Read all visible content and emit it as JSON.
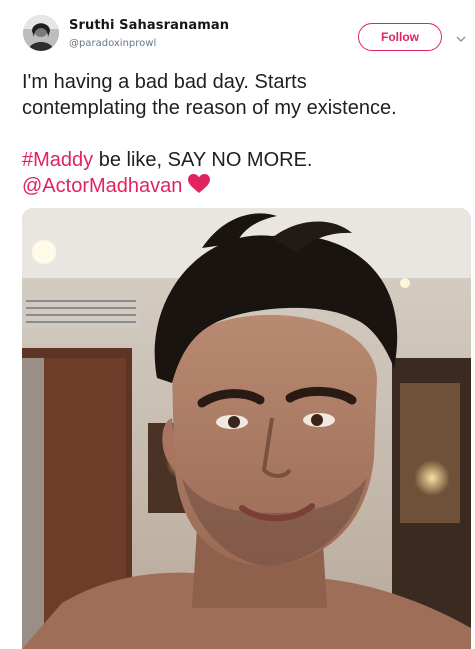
{
  "author": {
    "display_name": "Sruthi Sahasranaman",
    "handle": "@paradoxinprowl"
  },
  "actions": {
    "follow_label": "Follow"
  },
  "icons": {
    "menu": "chevron-down-icon",
    "like": "heart-icon"
  },
  "tweet": {
    "line1": "I'm having a bad bad day. Starts",
    "line2": "contemplating the reason of my existence.",
    "hashtag": "#Maddy",
    "line3_rest": " be like, SAY NO MORE.",
    "mention": "@ActorMadhavan"
  },
  "colors": {
    "accent": "#e0245e",
    "text": "#1c2022",
    "muted": "#657786"
  }
}
